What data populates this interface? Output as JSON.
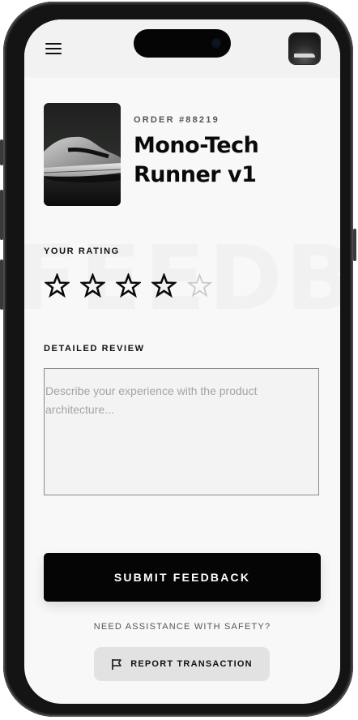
{
  "header": {
    "menu_icon": "hamburger-menu-icon",
    "avatar_alt": "profile-thumbnail"
  },
  "watermark": "FEEDBACK",
  "product": {
    "order_label": "ORDER #88219",
    "title": "Mono-Tech Runner v1",
    "image": "sneaker-product-image"
  },
  "rating": {
    "label": "YOUR RATING",
    "value": 4,
    "max": 5
  },
  "review": {
    "label": "DETAILED REVIEW",
    "value": "",
    "placeholder": "Describe your experience with the product architecture..."
  },
  "actions": {
    "submit_label": "SUBMIT FEEDBACK",
    "assist_text": "NEED ASSISTANCE WITH SAFETY?",
    "report_label": "REPORT TRANSACTION",
    "report_icon": "flag-icon"
  },
  "colors": {
    "primary": "#050505",
    "background": "#f8f8f8",
    "star_inactive": "#c8c8c8",
    "secondary_button": "#e2e2e2"
  }
}
